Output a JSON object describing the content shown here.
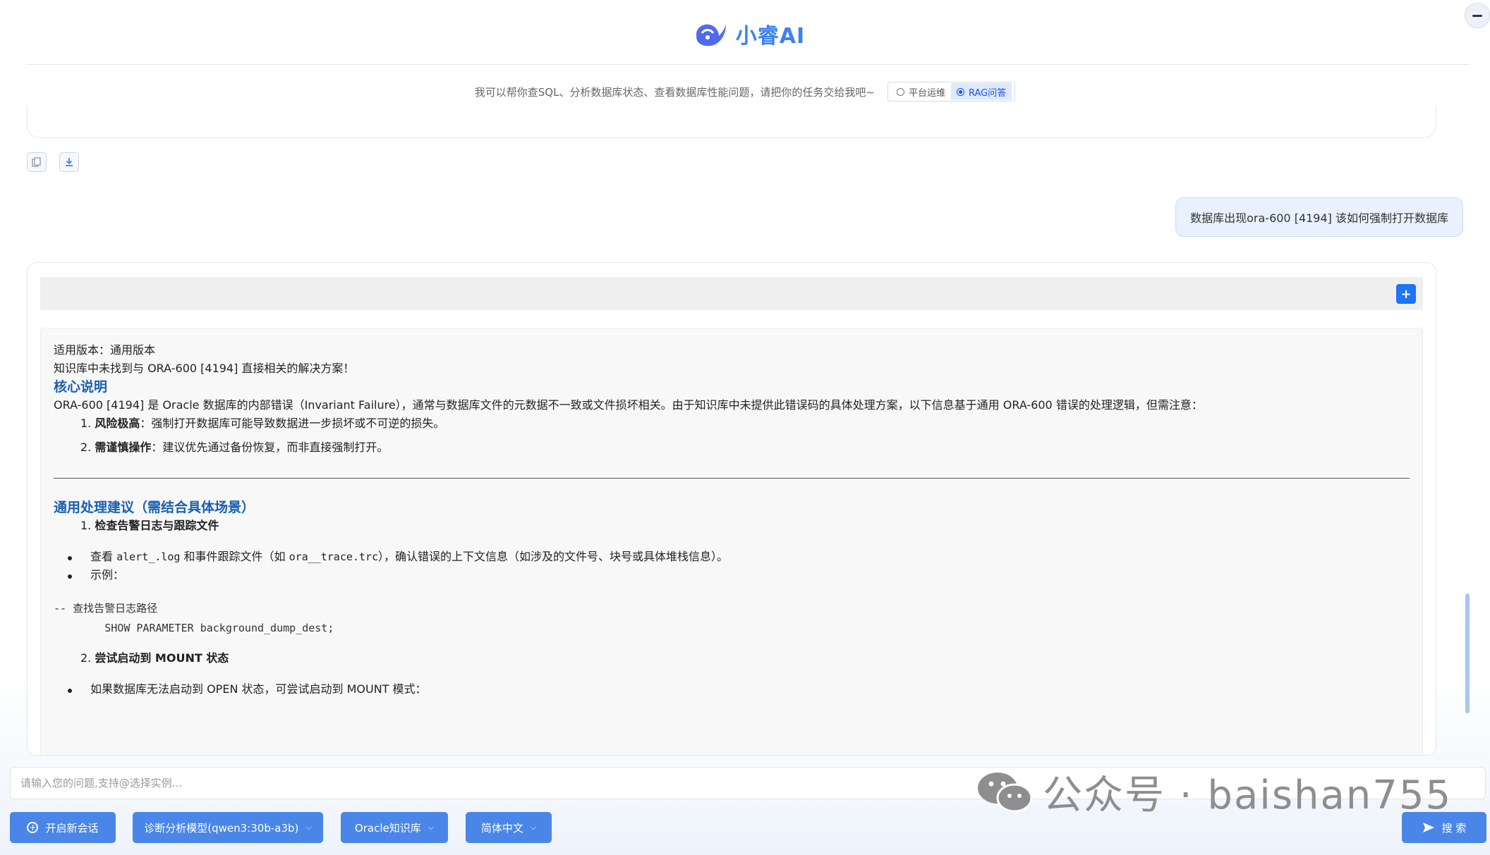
{
  "app": {
    "title": "小睿AI",
    "subtitle": "我可以帮你查SQL、分析数据库状态、查看数据库性能问题，请把你的任务交给我吧~",
    "modes": [
      {
        "label": "平台运维",
        "selected": false
      },
      {
        "label": "RAG问答",
        "selected": true
      }
    ],
    "accent_color": "#3b82f6"
  },
  "toolbar": {
    "copy_icon": "copy-icon",
    "download_icon": "download-icon"
  },
  "user_message": {
    "text": "数据库出现ora-600 [4194] 该如何强制打开数据库"
  },
  "answer": {
    "expand_label": "+",
    "version_line": "适用版本：通用版本",
    "not_found_line": "知识库中未找到与 ORA-600 [4194] 直接相关的解决方案！",
    "section1_title": "核心说明",
    "section1_intro": "ORA-600 [4194] 是 Oracle 数据库的内部错误（Invariant Failure），通常与数据库文件的元数据不一致或文件损坏相关。由于知识库中未提供此错误码的具体处理方案，以下信息基于通用 ORA-600 错误的处理逻辑，但需注意：",
    "section1_items": [
      {
        "num": "1.",
        "bold": "风险极高",
        "text": "：强制打开数据库可能导致数据进一步损坏或不可逆的损失。"
      },
      {
        "num": "2.",
        "bold": "需谨慎操作",
        "text": "：建议优先通过备份恢复，而非直接强制打开。"
      }
    ],
    "section2_title": "通用处理建议（需结合具体场景）",
    "step1_num": "1.",
    "step1_title": "检查告警日志与跟踪文件",
    "step1_bullets": {
      "b1_pre": "查看 ",
      "b1_code1": "alert_.log",
      "b1_mid": " 和事件跟踪文件（如 ",
      "b1_code2": "ora__trace.trc",
      "b1_post": "），确认错误的上下文信息（如涉及的文件号、块号或具体堆栈信息）。",
      "b2": "示例："
    },
    "code_line1": "-- 查找告警日志路径",
    "code_line2": "        SHOW PARAMETER background_dump_dest;",
    "step2_num": "2.",
    "step2_title": "尝试启动到 MOUNT 状态",
    "step2_bullet": "如果数据库无法启动到 OPEN 状态，可尝试启动到 MOUNT 模式："
  },
  "input": {
    "placeholder": "请输入您的问题,支持@选择实例..."
  },
  "buttons": {
    "new_chat": "开启新会话",
    "model": "诊断分析模型(qwen3:30b-a3b)",
    "knowledge": "Oracle知识库",
    "language": "简体中文",
    "search": "搜 索"
  },
  "watermark": {
    "text": "公众号 · baishan755",
    "icon": "wechat-icon"
  }
}
